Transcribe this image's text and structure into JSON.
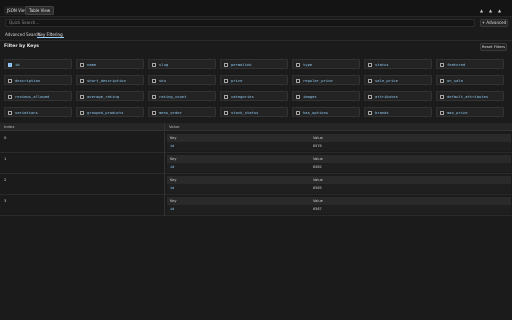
{
  "header": {
    "tabs": [
      {
        "label": "JSON View"
      },
      {
        "label": "Table View"
      }
    ],
    "nav": [
      "▲",
      "▲",
      "▲"
    ]
  },
  "search": {
    "placeholder": "Quick Search...",
    "advanced_label": "+ Advanced"
  },
  "modes": [
    {
      "label": "Advanced Search"
    },
    {
      "label": "Key Filtering"
    }
  ],
  "filter": {
    "title": "Filter by Keys",
    "reset_label": "Reset Filters",
    "keys": [
      {
        "label": "id",
        "checked": true
      },
      {
        "label": "name",
        "checked": false
      },
      {
        "label": "slug",
        "checked": false
      },
      {
        "label": "permalink",
        "checked": false
      },
      {
        "label": "type",
        "checked": false
      },
      {
        "label": "status",
        "checked": false
      },
      {
        "label": "featured",
        "checked": false
      },
      {
        "label": "description",
        "checked": false
      },
      {
        "label": "short_description",
        "checked": false
      },
      {
        "label": "sku",
        "checked": false
      },
      {
        "label": "price",
        "checked": false
      },
      {
        "label": "regular_price",
        "checked": false
      },
      {
        "label": "sale_price",
        "checked": false
      },
      {
        "label": "on_sale",
        "checked": false
      },
      {
        "label": "reviews_allowed",
        "checked": false
      },
      {
        "label": "average_rating",
        "checked": false
      },
      {
        "label": "rating_count",
        "checked": false
      },
      {
        "label": "categories",
        "checked": false
      },
      {
        "label": "images",
        "checked": false
      },
      {
        "label": "attributes",
        "checked": false
      },
      {
        "label": "default_attributes",
        "checked": false
      },
      {
        "label": "variations",
        "checked": false
      },
      {
        "label": "grouped_products",
        "checked": false
      },
      {
        "label": "menu_order",
        "checked": false
      },
      {
        "label": "stock_status",
        "checked": false
      },
      {
        "label": "has_options",
        "checked": false
      },
      {
        "label": "brands",
        "checked": false
      },
      {
        "label": "max_price",
        "checked": false
      }
    ]
  },
  "table": {
    "headers": {
      "index": "Index",
      "value": "Value"
    },
    "inner_headers": {
      "key": "Key",
      "value": "Value"
    },
    "rows": [
      {
        "index": "0",
        "key": "id",
        "value": "6576"
      },
      {
        "index": "1",
        "key": "id",
        "value": "6582"
      },
      {
        "index": "2",
        "key": "id",
        "value": "6585"
      },
      {
        "index": "3",
        "key": "id",
        "value": "6587"
      }
    ]
  },
  "colors": {
    "accent": "#8ec9f0",
    "background": "#1b1b1b"
  }
}
